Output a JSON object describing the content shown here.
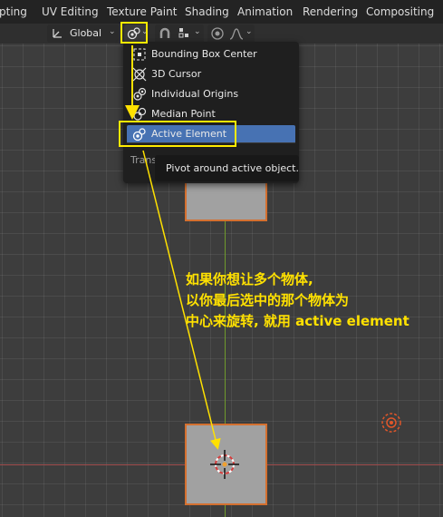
{
  "menubar": {
    "items": [
      "pting",
      "UV Editing",
      "Texture Paint",
      "Shading",
      "Animation",
      "Rendering",
      "Compositing"
    ]
  },
  "toolbar": {
    "orientation_label": "Global"
  },
  "pivot_menu": {
    "items": [
      {
        "label": "Bounding Box Center",
        "icon": "bounding-box-center-icon"
      },
      {
        "label": "3D Cursor",
        "icon": "3d-cursor-icon"
      },
      {
        "label": "Individual Origins",
        "icon": "individual-origins-icon"
      },
      {
        "label": "Median Point",
        "icon": "median-point-icon"
      },
      {
        "label": "Active Element",
        "icon": "active-element-icon"
      }
    ],
    "selected_index": 4,
    "footer_text": "Trans"
  },
  "tooltip": {
    "text": "Pivot around active object."
  },
  "annotation": {
    "lines": [
      "如果你想让多个物体,",
      "以你最后选中的那个物体为",
      "中心来旋转, 就用 active element"
    ]
  },
  "colors": {
    "annotation": "#ffe100",
    "selection": "#4772b3",
    "object_outline": "#d4702f",
    "y_axis": "#6f9a2d",
    "x_axis": "#a14c4c"
  }
}
